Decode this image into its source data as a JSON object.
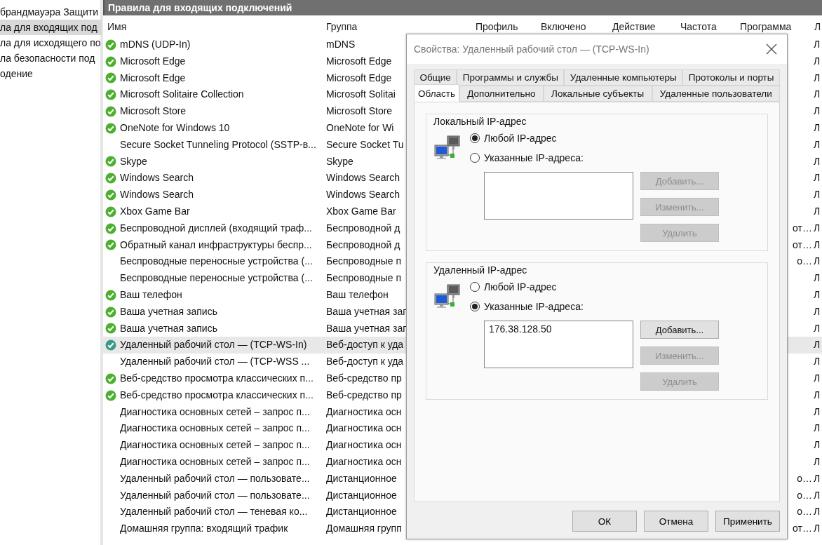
{
  "sidebar": {
    "items": [
      {
        "label": "брандмауэра Защити",
        "selected": false
      },
      {
        "label": "ла для входящих под",
        "selected": true
      },
      {
        "label": "ла для исходящего по",
        "selected": false
      },
      {
        "label": "ла безопасности под",
        "selected": false
      },
      {
        "label": "одение",
        "selected": false
      }
    ]
  },
  "panel": {
    "title": "Правила для входящих подключений"
  },
  "table": {
    "columns": [
      "Имя",
      "Группа",
      "Профиль",
      "Включено",
      "Действие",
      "Частота",
      "Программа",
      "Л"
    ],
    "rows": [
      {
        "name": "mDNS (UDP-In)",
        "group": "mDNS",
        "enabled": true,
        "selected": false,
        "column_8": "Л"
      },
      {
        "name": "Microsoft Edge",
        "group": "Microsoft Edge",
        "enabled": true,
        "selected": false,
        "column_8": "Л"
      },
      {
        "name": "Microsoft Edge",
        "group": "Microsoft Edge",
        "enabled": true,
        "selected": false,
        "column_8": "Л"
      },
      {
        "name": "Microsoft Solitaire Collection",
        "group": "Microsoft Solitai",
        "enabled": true,
        "selected": false,
        "column_8": "Л"
      },
      {
        "name": "Microsoft Store",
        "group": "Microsoft Store",
        "enabled": true,
        "selected": false,
        "column_8": "Л"
      },
      {
        "name": "OneNote for Windows 10",
        "group": "OneNote for Wi",
        "enabled": true,
        "selected": false,
        "column_8": "Л"
      },
      {
        "name": "Secure Socket Tunneling Protocol (SSTP-в...",
        "group": "Secure Socket Tu",
        "enabled": false,
        "selected": false,
        "column_8": "Л"
      },
      {
        "name": "Skype",
        "group": "Skype",
        "enabled": true,
        "selected": false,
        "column_8": "Л"
      },
      {
        "name": "Windows Search",
        "group": "Windows Search",
        "enabled": true,
        "selected": false,
        "column_8": "Л"
      },
      {
        "name": "Windows Search",
        "group": "Windows Search",
        "enabled": true,
        "selected": false,
        "column_8": "Л"
      },
      {
        "name": "Xbox Game Bar",
        "group": "Xbox Game Bar",
        "enabled": true,
        "selected": false,
        "column_8": "Л"
      },
      {
        "name": "Беспроводной дисплей (входящий траф...",
        "group": "Беспроводной д",
        "enabled": true,
        "selected": false,
        "program": "от…",
        "column_8": "Л"
      },
      {
        "name": "Обратный канал инфраструктуры беспр...",
        "group": "Беспроводной д",
        "enabled": true,
        "selected": false,
        "program": "от…",
        "column_8": "Л"
      },
      {
        "name": "Беспроводные переносные устройства (...",
        "group": "Беспроводные п",
        "enabled": false,
        "selected": false,
        "program": "о…",
        "column_8": "Л"
      },
      {
        "name": "Беспроводные переносные устройства (...",
        "group": "Беспроводные п",
        "enabled": false,
        "selected": false,
        "column_8": "Л"
      },
      {
        "name": "Ваш телефон",
        "group": "Ваш телефон",
        "enabled": true,
        "selected": false,
        "column_8": "Л"
      },
      {
        "name": "Ваша учетная запись",
        "group": "Ваша учетная зап",
        "enabled": true,
        "selected": false,
        "column_8": "Л"
      },
      {
        "name": "Ваша учетная запись",
        "group": "Ваша учетная зап",
        "enabled": true,
        "selected": false,
        "column_8": "Л"
      },
      {
        "name": "Удаленный рабочий стол — (TCP-WS-In)",
        "group": "Веб-доступ к уда",
        "enabled": true,
        "selected": true,
        "column_8": "Л"
      },
      {
        "name": "Удаленный рабочий стол — (TCP-WSS ...",
        "group": "Веб-доступ к уда",
        "enabled": false,
        "selected": false,
        "column_8": "Л"
      },
      {
        "name": "Веб-средство просмотра классических п...",
        "group": "Веб-средство пр",
        "enabled": true,
        "selected": false,
        "column_8": "Л"
      },
      {
        "name": "Веб-средство просмотра классических п...",
        "group": "Веб-средство пр",
        "enabled": true,
        "selected": false,
        "column_8": "Л"
      },
      {
        "name": "Диагностика основных сетей – запрос п...",
        "group": "Диагностика осн",
        "enabled": false,
        "selected": false,
        "column_8": "Л"
      },
      {
        "name": "Диагностика основных сетей – запрос п...",
        "group": "Диагностика осн",
        "enabled": false,
        "selected": false,
        "column_8": "Л"
      },
      {
        "name": "Диагностика основных сетей – запрос п...",
        "group": "Диагностика осн",
        "enabled": false,
        "selected": false,
        "column_8": "Л"
      },
      {
        "name": "Диагностика основных сетей – запрос п...",
        "group": "Диагностика осн",
        "enabled": false,
        "selected": false,
        "column_8": "Л"
      },
      {
        "name": "Удаленный рабочий стол — пользовате...",
        "group": "Дистанционное",
        "enabled": false,
        "selected": false,
        "program": "о…",
        "column_8": "Л"
      },
      {
        "name": "Удаленный рабочий стол — пользовате...",
        "group": "Дистанционное",
        "enabled": false,
        "selected": false,
        "program": "о…",
        "column_8": "Л"
      },
      {
        "name": "Удаленный рабочий стол — теневая ко...",
        "group": "Дистанционное",
        "enabled": false,
        "selected": false,
        "program": "о…",
        "column_8": "Л"
      },
      {
        "name": "Домашняя группа: входящий трафик",
        "group": "Домашняя групп",
        "enabled": false,
        "selected": false,
        "program": "от…",
        "column_8": "Л"
      }
    ]
  },
  "dialog": {
    "title": "Свойства: Удаленный рабочий стол — (TCP-WS-In)",
    "tab_rows": [
      [
        {
          "label": "Общие",
          "selected": false
        },
        {
          "label": "Программы и службы",
          "selected": false
        },
        {
          "label": "Удаленные компьютеры",
          "selected": false
        },
        {
          "label": "Протоколы и порты",
          "selected": false
        }
      ],
      [
        {
          "label": "Область",
          "selected": true
        },
        {
          "label": "Дополнительно",
          "selected": false
        },
        {
          "label": "Локальные субъекты",
          "selected": false
        },
        {
          "label": "Удаленные пользователи",
          "selected": false
        }
      ]
    ],
    "scopes": [
      {
        "title": "Локальный IP-адрес",
        "options": [
          {
            "label": "Любой IP-адрес",
            "selected": true
          },
          {
            "label": "Указанные IP-адреса:",
            "selected": false
          }
        ],
        "buttons": [
          {
            "label": "Добавить...",
            "disabled": true
          },
          {
            "label": "Изменить...",
            "disabled": true
          },
          {
            "label": "Удалить",
            "disabled": true
          }
        ]
      },
      {
        "title": "Удаленный IP-адрес",
        "options": [
          {
            "label": "Любой IP-адрес",
            "selected": false
          },
          {
            "label": "Указанные IP-адреса:",
            "selected": true
          }
        ],
        "addresses": [
          "176.38.128.50"
        ],
        "buttons": [
          {
            "label": "Добавить...",
            "disabled": false
          },
          {
            "label": "Изменить...",
            "disabled": true
          },
          {
            "label": "Удалить",
            "disabled": true
          }
        ]
      }
    ],
    "buttons": [
      "ОК",
      "Отмена",
      "Применить"
    ]
  }
}
